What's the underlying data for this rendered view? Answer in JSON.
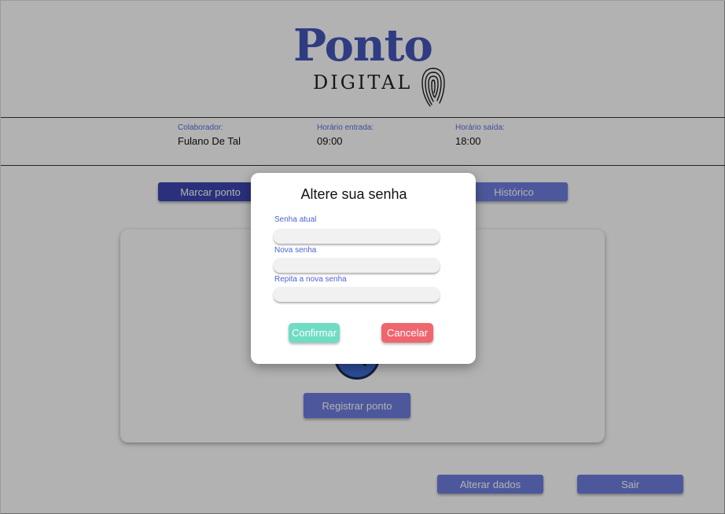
{
  "logo": {
    "word1": "Ponto",
    "word2": "DIGITAL",
    "icon": "fingerprint-icon"
  },
  "header": {
    "collaborator_label": "Colaborador:",
    "collaborator_value": "Fulano De Tal",
    "entry_label": "Horário entrada:",
    "entry_value": "09:00",
    "exit_label": "Horário saída:",
    "exit_value": "18:00"
  },
  "nav": {
    "mark_label": "Marcar ponto",
    "history_label": "Histórico"
  },
  "main": {
    "clock_icon": "clock-icon",
    "register_label": "Registrar ponto"
  },
  "footer": {
    "edit_label": "Alterar dados",
    "exit_label": "Sair"
  },
  "modal": {
    "title": "Altere sua senha",
    "current_label": "Senha atual",
    "new_label": "Nova senha",
    "repeat_label": "Repita a nova senha",
    "current_value": "",
    "new_value": "",
    "repeat_value": "",
    "confirm_label": "Confirmar",
    "cancel_label": "Cancelar"
  },
  "colors": {
    "brand": "#4557bb",
    "primary_button": "#3d45b0",
    "secondary_button": "#6f7fe0",
    "confirm": "#6fdcc4",
    "cancel": "#f0666e",
    "label_text": "#4a62d4"
  }
}
